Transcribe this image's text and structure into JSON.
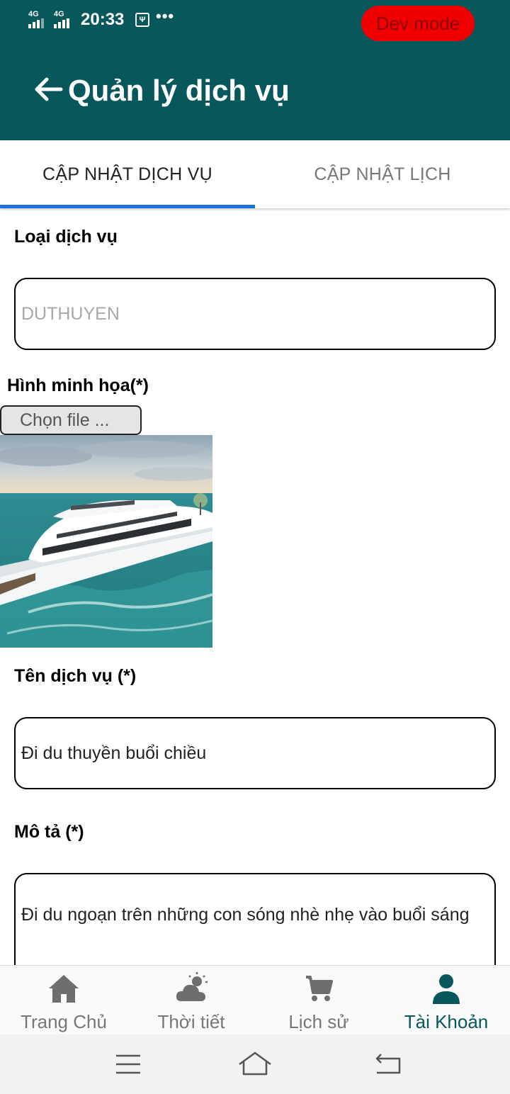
{
  "status_bar": {
    "signal_1": "4G",
    "signal_2": "4G",
    "time": "20:33",
    "usb_label": "Ψ",
    "more": "•••",
    "dev_mode": "Dev mode"
  },
  "header": {
    "title": "Quản lý dịch vụ"
  },
  "tabs": [
    {
      "label": "CẬP NHẬT DỊCH VỤ",
      "active": true
    },
    {
      "label": "CẬP NHẬT LỊCH",
      "active": false
    }
  ],
  "form": {
    "service_type_label": "Loại dịch vụ",
    "service_type_value": "DUTHUYEN",
    "image_label": "Hình minh họa(*)",
    "choose_file": "Chọn file ...",
    "service_name_label": "Tên dịch vụ (*)",
    "service_name_value": "Đi du thuyền buổi chiều",
    "description_label": "Mô tả (*)",
    "description_value": "Đi du ngoạn trên những con sóng nhè nhẹ vào buổi sáng"
  },
  "bottom_nav": [
    {
      "label": "Trang Chủ",
      "icon": "home-icon"
    },
    {
      "label": "Thời tiết",
      "icon": "weather-icon"
    },
    {
      "label": "Lịch sử",
      "icon": "cart-icon"
    },
    {
      "label": "Tài Khoản",
      "icon": "account-icon",
      "active": true
    }
  ],
  "colors": {
    "header": "#07575b",
    "tab_indicator": "#1a73d8",
    "dev_badge": "#f20000",
    "active_nav": "#07575b"
  }
}
